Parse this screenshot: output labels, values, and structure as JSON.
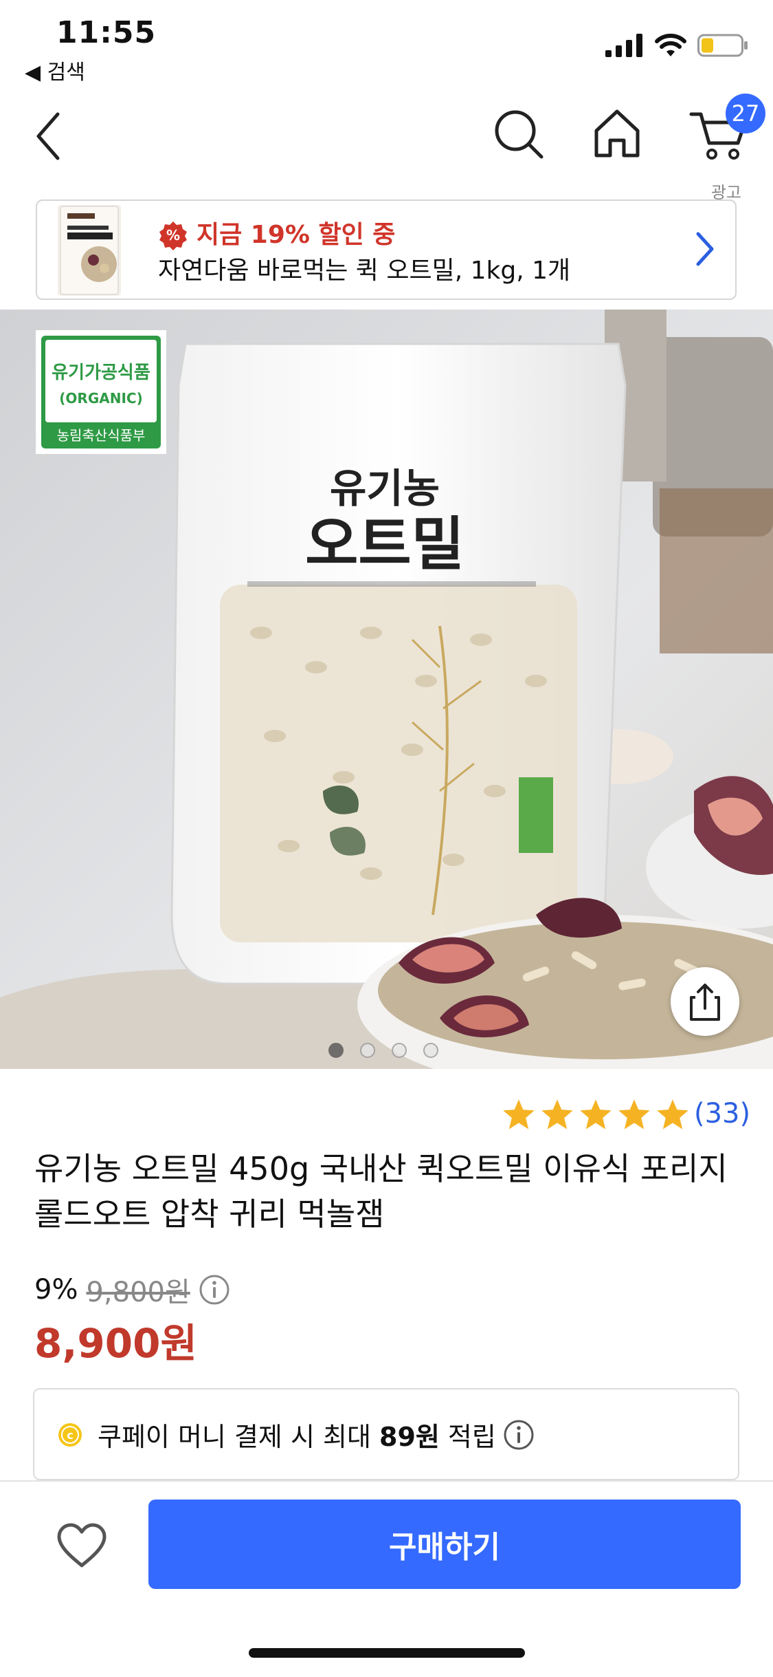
{
  "status_bar": {
    "time": "11:55",
    "back_to_app": "◀ 검색"
  },
  "nav": {
    "cart_count": "27"
  },
  "ad": {
    "label": "광고",
    "promo": "지금 19% 할인 중",
    "title": "자연다움 바로먹는 퀵 오트밀, 1kg, 1개"
  },
  "product": {
    "rating_count": "(33)",
    "title": "유기농 오트밀 450g 국내산 퀵오트밀 이유식 포리지 롤드오트 압착 귀리 먹놀잼",
    "discount_rate": "9%",
    "original_price": "9,800원",
    "sale_price": "8,900원",
    "image_count": 4,
    "current_image": 1,
    "rating_stars": 5,
    "package_texts": {
      "cert_line1": "유기가공식품",
      "cert_line2": "(ORGANIC)",
      "cert_line3": "농림축산식품부",
      "pkg_line1": "유기농",
      "pkg_line2": "오트밀"
    }
  },
  "cashback": {
    "text_before": "쿠페이 머니 결제 시 최대 ",
    "amount": "89원",
    "text_after": " 적립"
  },
  "bottom_bar": {
    "buy_label": "구매하기"
  },
  "colors": {
    "accent": "#346aff",
    "sale_red": "#c0392b",
    "promo_red": "#d0352a",
    "star": "#f5b324"
  }
}
